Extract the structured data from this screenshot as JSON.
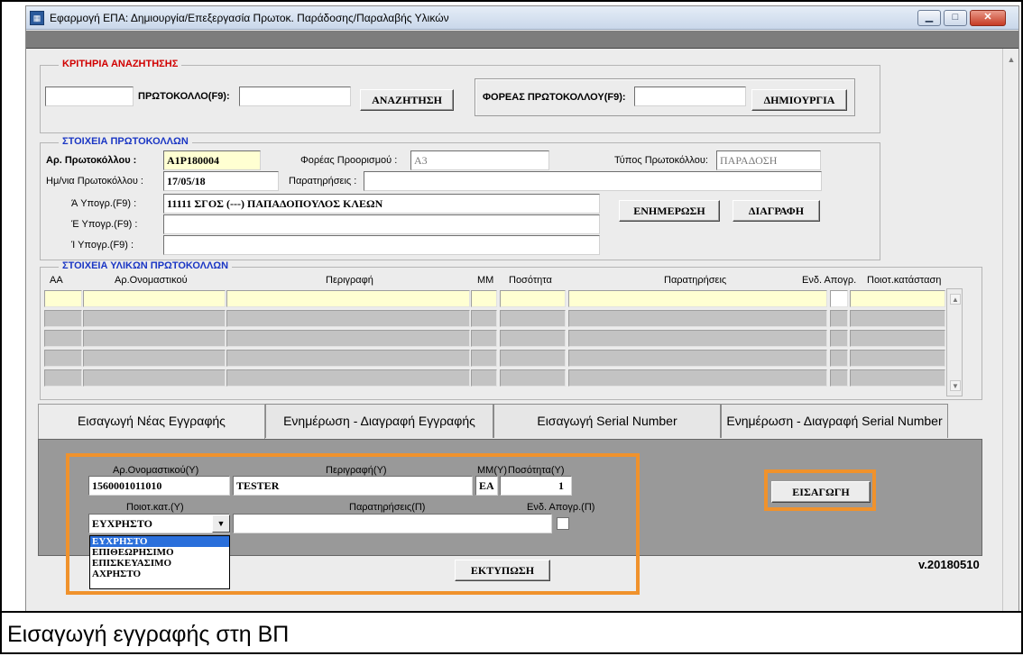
{
  "window": {
    "title": "Εφαρμογή ΕΠΑ: Δημιουργία/Επεξεργασία Πρωτοκ. Παράδοσης/Παραλαβής Υλικών",
    "minimize_glyph": "▁",
    "maximize_glyph": "□",
    "close_glyph": "✕"
  },
  "search": {
    "legend": "ΚΡΙΤΗΡΙΑ ΑΝΑΖΗΤΗΣΗΣ",
    "prefix_value": "",
    "protocol_label": "ΠΡΩΤΟΚΟΛΛΟ(F9):",
    "protocol_value": "",
    "search_button": "ΑΝΑΖΗΤΗΣΗ",
    "carrier_label": "ΦΟΡΕΑΣ ΠΡΩΤΟΚΟΛΛΟΥ(F9):",
    "carrier_value": "",
    "create_button": "ΔΗΜΙΟΥΡΓΙΑ"
  },
  "protocol": {
    "legend": "ΣΤΟΙΧΕΙΑ ΠΡΩΤΟΚΟΛΛΩΝ",
    "number_label": "Αρ. Πρωτοκόλλου :",
    "number_value": "Α1Ρ180004",
    "dest_label": "Φορέας Προορισμού :",
    "dest_value": "Α3",
    "type_label": "Τύπος Πρωτοκόλλου:",
    "type_value": "ΠΑΡΑΔΟΣΗ",
    "date_label": "Ημ/νια Πρωτοκόλλου :",
    "date_value": "17/05/18",
    "notes_label": "Παρατηρήσεις :",
    "notes_value": "",
    "sig_a_label": "Ά Υπογρ.(F9) :",
    "sig_a_value": "11111 ΣΓΟΣ (---) ΠΑΠΑΔΟΠΟΥΛΟΣ ΚΛΕΩΝ",
    "sig_b_label": "Έ Υπογρ.(F9) :",
    "sig_b_value": "",
    "sig_c_label": "Ί Υπογρ.(F9) :",
    "sig_c_value": "",
    "update_button": "ΕΝΗΜΕΡΩΣΗ",
    "delete_button": "ΔΙΑΓΡΑΦΗ"
  },
  "items": {
    "legend": "ΣΤΟΙΧΕΙΑ ΥΛΙΚΩΝ ΠΡΩΤΟΚΟΛΛΩΝ",
    "columns": [
      "ΑΑ",
      "Αρ.Ονομαστικού",
      "Περιγραφή",
      "ΜΜ",
      "Ποσότητα",
      "Παρατηρήσεις",
      "Ενδ. Απογρ.",
      "Ποιοτ.κατάσταση"
    ],
    "row_count": 5
  },
  "tabs": [
    {
      "label": "Εισαγωγή Νέας Εγγραφής",
      "active": true
    },
    {
      "label": "Ενημέρωση - Διαγραφή Εγγραφής",
      "active": false
    },
    {
      "label": "Εισαγωγή Serial Number",
      "active": false
    },
    {
      "label": "Ενημέρωση - Διαγραφή Serial Number",
      "active": false
    }
  ],
  "entry": {
    "code_label": "Αρ.Ονομαστικού(Υ)",
    "code_value": "1560001011010",
    "desc_label": "Περιγραφή(Υ)",
    "desc_value": "TESTER",
    "unit_label": "ΜΜ(Υ)",
    "unit_value": "ΕΑ",
    "qty_label": "Ποσότητα(Υ)",
    "qty_value": "1",
    "quality_label": "Ποιοτ.κατ.(Υ)",
    "quality_value": "ΕΥΧΡΗΣΤΟ",
    "quality_options": [
      "ΕΥΧΡΗΣΤΟ",
      "ΕΠΙΘΕΩΡΗΣΙΜΟ",
      "ΕΠΙΣΚΕΥΑΣΙΜΟ",
      "ΑΧΡΗΣΤΟ"
    ],
    "remarks_label": "Παρατηρήσεις(Π)",
    "remarks_value": "",
    "inventory_label": "Ενδ. Απογρ.(Π)",
    "inventory_checked": false,
    "insert_button": "ΕΙΣΑΓΩΓΗ",
    "print_button": "ΕΚΤΥΠΩΣΗ"
  },
  "version": "v.20180510",
  "caption": "Εισαγωγή εγγραφής στη ΒΠ",
  "colors": {
    "highlight": "#f0922c",
    "legend_blue": "#1a36c4",
    "legend_red": "#d10000",
    "required_yellow": "#ffffd2"
  }
}
